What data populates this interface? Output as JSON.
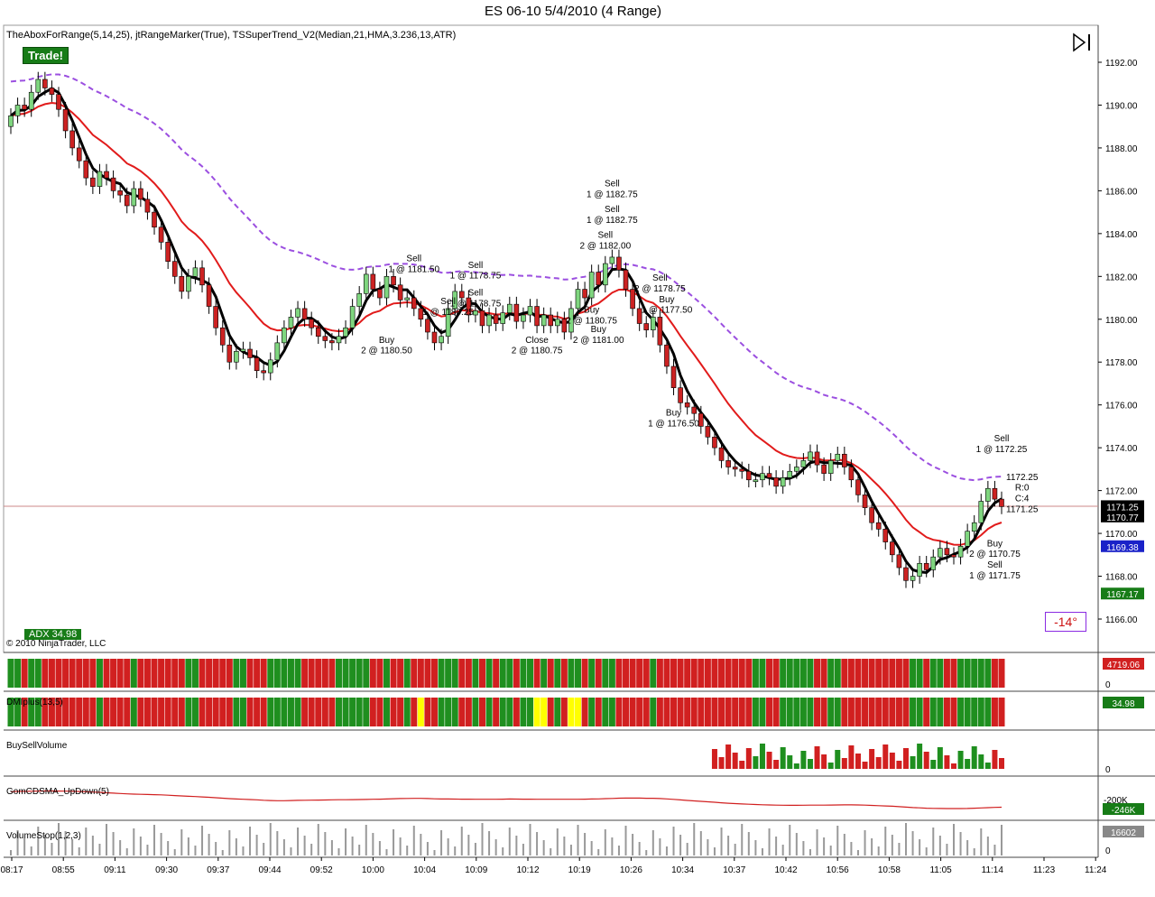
{
  "header": {
    "title": "ES 06-10  5/4/2010 (4 Range)",
    "indicators": "TheAboxForRange(5,14,25), jtRangeMarker(True), TSSuperTrend_V2(Median,21,HMA,3.236,13,ATR)",
    "trade_badge": "Trade!",
    "copyright": "© 2010 NinjaTrader, LLC",
    "adx_badge": "ADX 34.98",
    "angle_badge": "-14°"
  },
  "colors": {
    "up_candle": "#7fd67f",
    "down_candle": "#cc2222",
    "ma_black": "#000000",
    "ma_red": "#e11b1b",
    "ma_blue": "#1a22c8",
    "ma_purple_dashed": "#9b4fe0",
    "stop_green": "#2e8b2e",
    "panel_green": "#1f8f1f",
    "panel_red": "#d12020",
    "panel_yellow": "#ffff00"
  },
  "chart_data": [
    {
      "type": "candlestick",
      "title": "ES 06-10  5/4/2010 (4 Range)",
      "ylim": [
        1165,
        1193
      ],
      "y_ticks": [
        "1192.00",
        "1190.00",
        "1188.00",
        "1186.00",
        "1184.00",
        "1182.00",
        "1180.00",
        "1178.00",
        "1176.00",
        "1174.00",
        "1172.00",
        "1170.00",
        "1168.00",
        "1166.00"
      ],
      "x_ticks": [
        "08:17",
        "08:55",
        "09:11",
        "09:30",
        "09:37",
        "09:44",
        "09:52",
        "10:00",
        "10:04",
        "10:09",
        "10:12",
        "10:19",
        "10:26",
        "10:34",
        "10:37",
        "10:42",
        "10:56",
        "10:58",
        "11:05",
        "11:14",
        "11:23",
        "11:24"
      ],
      "closes": [
        1189.5,
        1190.0,
        1189.8,
        1190.6,
        1191.2,
        1190.8,
        1190.5,
        1189.8,
        1188.8,
        1188.0,
        1187.4,
        1186.6,
        1186.2,
        1186.9,
        1186.6,
        1186.0,
        1185.8,
        1185.3,
        1186.1,
        1185.6,
        1185.0,
        1184.3,
        1183.6,
        1182.7,
        1182.0,
        1181.3,
        1182.0,
        1182.4,
        1181.6,
        1180.6,
        1179.6,
        1178.8,
        1178.0,
        1178.5,
        1178.6,
        1178.2,
        1177.6,
        1177.5,
        1178.1,
        1178.9,
        1179.6,
        1180.1,
        1180.5,
        1180.0,
        1179.6,
        1179.2,
        1179.0,
        1178.9,
        1179.2,
        1179.6,
        1180.6,
        1181.2,
        1182.1,
        1181.4,
        1181.0,
        1182.0,
        1181.6,
        1180.9,
        1181.0,
        1180.5,
        1180.0,
        1179.4,
        1178.9,
        1179.2,
        1180.5,
        1181.3,
        1181.0,
        1180.2,
        1180.4,
        1179.7,
        1180.2,
        1179.8,
        1180.3,
        1180.7,
        1179.9,
        1180.2,
        1180.6,
        1179.7,
        1180.2,
        1179.7,
        1180.0,
        1179.4,
        1180.5,
        1181.4,
        1181.0,
        1182.2,
        1181.6,
        1182.6,
        1182.9,
        1182.3,
        1181.4,
        1180.5,
        1179.8,
        1179.5,
        1180.1,
        1178.8,
        1177.8,
        1176.8,
        1176.1,
        1175.9,
        1175.6,
        1175.0,
        1174.5,
        1174.0,
        1173.4,
        1173.1,
        1173.0,
        1172.9,
        1172.5,
        1172.5,
        1172.8,
        1172.6,
        1172.2,
        1172.6,
        1172.9,
        1173.1,
        1173.4,
        1173.8,
        1173.2,
        1172.8,
        1173.4,
        1173.7,
        1173.1,
        1172.5,
        1171.8,
        1171.2,
        1170.5,
        1170.2,
        1169.6,
        1169.0,
        1168.4,
        1167.8,
        1168.0,
        1168.6,
        1168.3,
        1168.9,
        1169.3,
        1169.0,
        1168.9,
        1169.4,
        1170.1,
        1170.5,
        1171.5,
        1172.1,
        1171.6,
        1171.25
      ],
      "stats": {
        "ADX": 34.98
      }
    }
  ],
  "price_labels": [
    {
      "text": "1171.25",
      "price": 1171.25,
      "color": "#000000"
    },
    {
      "text": "1170.77",
      "price": 1170.77,
      "color": "#000000"
    },
    {
      "text": "1169.38",
      "price": 1169.38,
      "color": "#1a22c8"
    },
    {
      "text": "1167.17",
      "price": 1167.17,
      "color": "#177c17"
    }
  ],
  "annotations": [
    {
      "text": "Sell",
      "bar": 59,
      "price": 1182.7
    },
    {
      "text": "1 @ 1181.50",
      "bar": 59,
      "price": 1182.2
    },
    {
      "text": "Buy",
      "bar": 55,
      "price": 1178.9
    },
    {
      "text": "2 @ 1180.50",
      "bar": 55,
      "price": 1178.4
    },
    {
      "text": "Sell",
      "bar": 64,
      "price": 1180.7
    },
    {
      "text": "1 @ 1180.25",
      "bar": 64,
      "price": 1180.2
    },
    {
      "text": "Sell",
      "bar": 68,
      "price": 1182.4
    },
    {
      "text": "1 @ 1178.75",
      "bar": 68,
      "price": 1181.9
    },
    {
      "text": "Sell",
      "bar": 68,
      "price": 1181.1
    },
    {
      "text": "1 @ 1178.75",
      "bar": 68,
      "price": 1180.6
    },
    {
      "text": "Close",
      "bar": 77,
      "price": 1178.9
    },
    {
      "text": "2 @ 1180.75",
      "bar": 77,
      "price": 1178.4
    },
    {
      "text": "Sell",
      "bar": 88,
      "price": 1186.2
    },
    {
      "text": "1 @ 1182.75",
      "bar": 88,
      "price": 1185.7
    },
    {
      "text": "Sell",
      "bar": 88,
      "price": 1185.0
    },
    {
      "text": "1 @ 1182.75",
      "bar": 88,
      "price": 1184.5
    },
    {
      "text": "Sell",
      "bar": 87,
      "price": 1183.8
    },
    {
      "text": "2 @ 1182.00",
      "bar": 87,
      "price": 1183.3
    },
    {
      "text": "Buy",
      "bar": 85,
      "price": 1180.3
    },
    {
      "text": "2 @ 1180.75",
      "bar": 85,
      "price": 1179.8
    },
    {
      "text": "Buy",
      "bar": 86,
      "price": 1179.4
    },
    {
      "text": "2 @ 1181.00",
      "bar": 86,
      "price": 1178.9
    },
    {
      "text": "Sell",
      "bar": 95,
      "price": 1181.8
    },
    {
      "text": "2 @ 1178.75",
      "bar": 95,
      "price": 1181.3
    },
    {
      "text": "Buy",
      "bar": 96,
      "price": 1180.8
    },
    {
      "text": "1 @ 1177.50",
      "bar": 96,
      "price": 1180.3
    },
    {
      "text": "Buy",
      "bar": 97,
      "price": 1175.5
    },
    {
      "text": "1 @ 1176.50",
      "bar": 97,
      "price": 1175.0
    },
    {
      "text": "Sell",
      "bar": 145,
      "price": 1174.3
    },
    {
      "text": "1 @ 1172.25",
      "bar": 145,
      "price": 1173.8
    },
    {
      "text": "1172.25",
      "bar": 148,
      "price": 1172.5
    },
    {
      "text": "R:0",
      "bar": 148,
      "price": 1172.0
    },
    {
      "text": "C:4",
      "bar": 148,
      "price": 1171.5
    },
    {
      "text": "1171.25",
      "bar": 148,
      "price": 1171.0
    },
    {
      "text": "Buy",
      "bar": 144,
      "price": 1169.4
    },
    {
      "text": "2 @ 1170.75",
      "bar": 144,
      "price": 1168.9
    },
    {
      "text": "Sell",
      "bar": 144,
      "price": 1168.4
    },
    {
      "text": "1 @ 1171.75",
      "bar": 144,
      "price": 1167.9
    }
  ],
  "panels": [
    {
      "name": "",
      "value_label": "4719.06",
      "label_color": "#d12020",
      "zero_label": "0"
    },
    {
      "name": "DMIplus(13,5)",
      "value_label": "34.98",
      "label_color": "#177c17"
    },
    {
      "name": "BuySellVolume",
      "zero_label": "0"
    },
    {
      "name": "GomCDSMA_UpDown(5)",
      "tick_label": "-200K",
      "value_label": "-246K",
      "label_color": "#177c17"
    },
    {
      "name": "VolumeStop(1,2,3)",
      "value_label": "16602",
      "label_color": "#888888",
      "zero_label": "0"
    }
  ]
}
